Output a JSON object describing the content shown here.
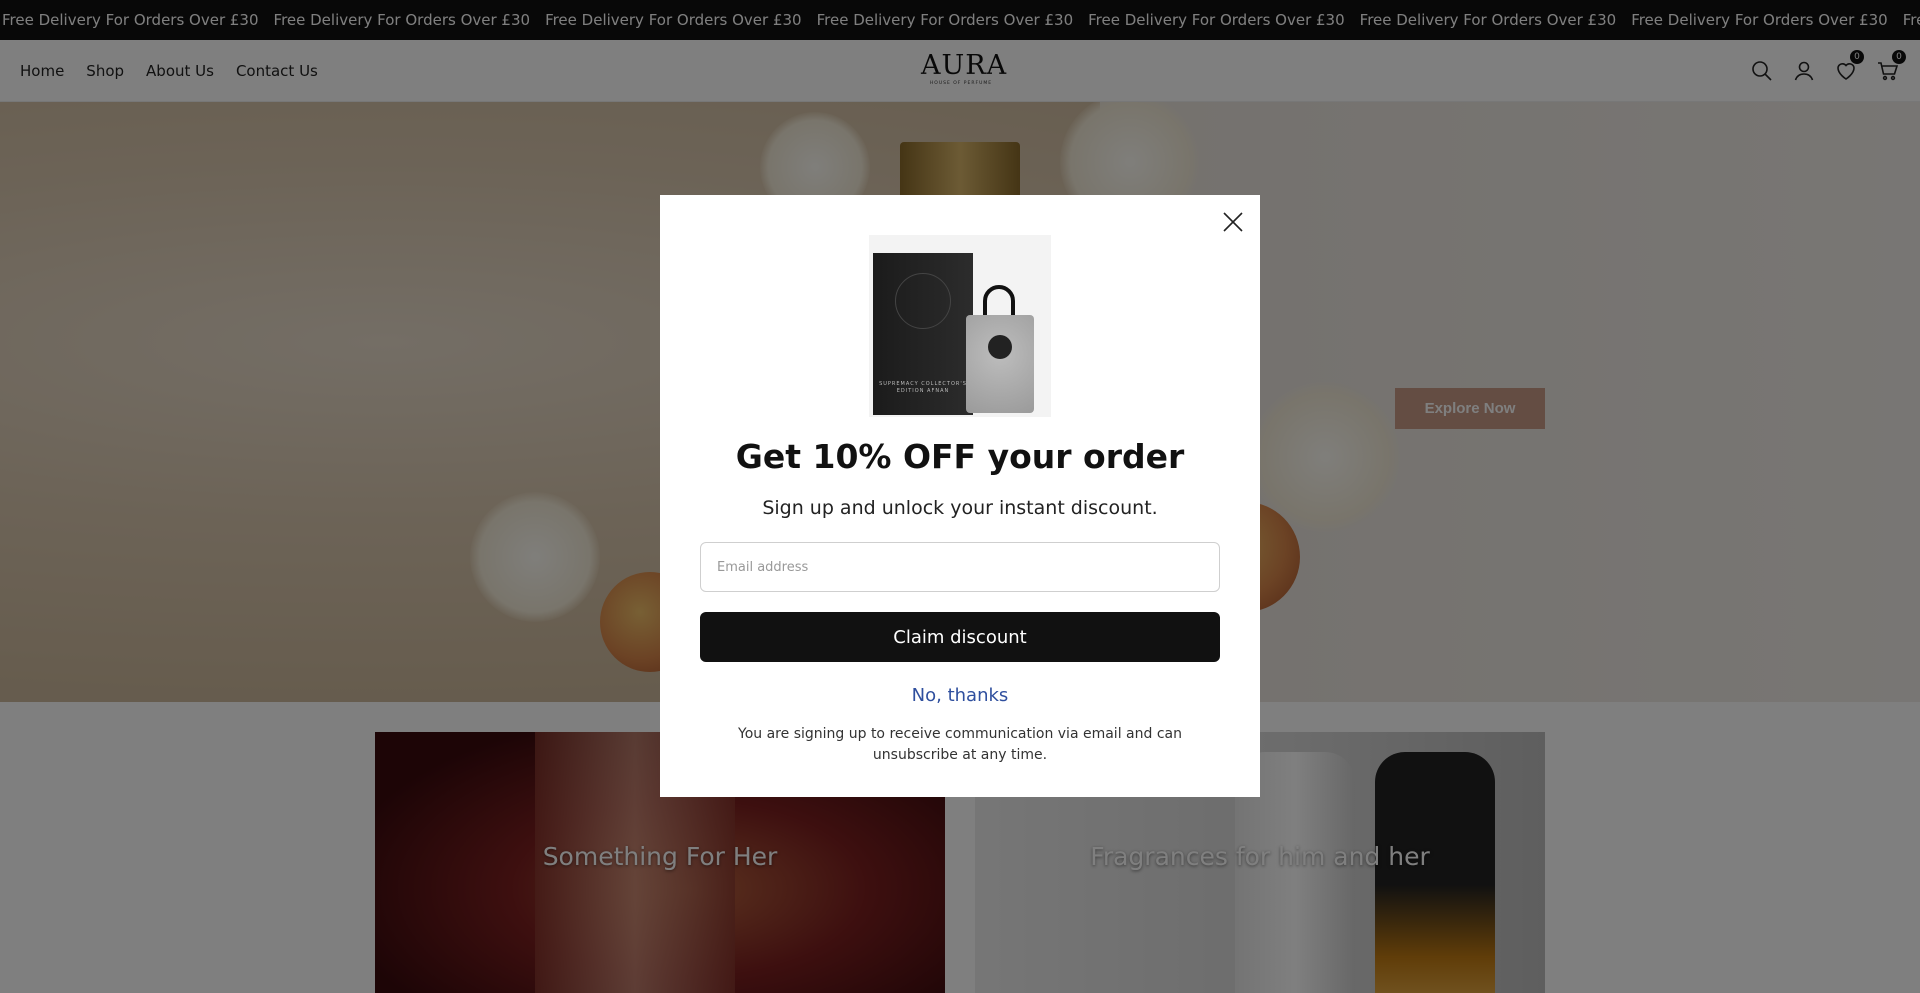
{
  "announcement": {
    "items": [
      "Free Delivery For Orders Over £30",
      "Free Delivery For Orders Over £30",
      "Free Delivery For Orders Over £30",
      "Free Delivery For Orders Over £30",
      "Free Delivery For Orders Over £30",
      "Free Delivery For Orders Over £30",
      "Free Delivery For Orders Over £30",
      "Free Delivery For Orders Over"
    ]
  },
  "header": {
    "nav": [
      "Home",
      "Shop",
      "About Us",
      "Contact Us"
    ],
    "logo": {
      "main": "AURA",
      "sub": "HOUSE OF PERFUME"
    },
    "icons": [
      "search-icon",
      "account-icon",
      "wishlist-icon",
      "cart-icon"
    ],
    "wishlist_count": "0",
    "cart_count": "0"
  },
  "hero": {
    "button_label": "Explore Now",
    "button_color": "#c89a86"
  },
  "collections": [
    {
      "title": "Something For Her"
    },
    {
      "title": "Fragrances for him and her"
    }
  ],
  "modal": {
    "title": "Get 10% OFF your order",
    "subtitle": "Sign up and unlock your instant discount.",
    "email_placeholder": "Email address",
    "email_value": "",
    "claim_label": "Claim discount",
    "no_thanks_label": "No, thanks",
    "disclaimer": "You are signing up to receive communication via email and can unsubscribe at any time.",
    "product_box_text": "SUPREMACY COLLECTOR'S EDITION AFNAN",
    "accent_color": "#2f4f9e"
  }
}
